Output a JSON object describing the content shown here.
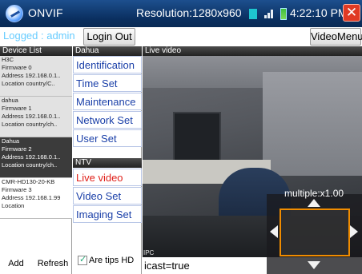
{
  "titlebar": {
    "app_title": "ONVIF",
    "resolution": "Resolution:1280x960",
    "clock": "4:22:10 PM",
    "close_glyph": "✕",
    "icons": [
      "app-logo-icon",
      "signal-icon",
      "network-icon",
      "battery-icon",
      "close-icon"
    ]
  },
  "toolbar": {
    "logged_status": "Logged : admin",
    "logout_label": "Login Out",
    "videomenu_label": "VideoMenu"
  },
  "device_list": {
    "header": "Device List",
    "devices": [
      {
        "name": "H3C",
        "firmware": "Firmware 0",
        "address": "Address 192.168.0.1..",
        "location": "Location country/C.."
      },
      {
        "name": "dahua",
        "firmware": "Firmware 1",
        "address": "Address 192.168.0.1..",
        "location": "Location country/ch.."
      },
      {
        "name": "Dahua",
        "firmware": "Firmware 2",
        "address": "Address 192.168.0.1..",
        "location": "Location country/ch.."
      },
      {
        "name": "CMR-HD130-20-KB",
        "firmware": "Firmware 3",
        "address": "Address 192.168.1.99",
        "location": "Location"
      }
    ],
    "selected_index": 2,
    "add_label": "Add",
    "refresh_label": "Refresh"
  },
  "menu": {
    "dahua_header": "Dahua",
    "items": [
      "Identification",
      "Time Set",
      "Maintenance",
      "Network Set",
      "User Set"
    ],
    "ntv_header": "NTV",
    "ntv_items": [
      "Live video",
      "Video Set",
      "Imaging Set"
    ],
    "active_item": "Live video",
    "tips_label": "Are tips HD",
    "tips_checked": true
  },
  "video": {
    "header": "Live video",
    "ipc_label": "IPC",
    "status_line": "icast=true",
    "multiple": "multiple:x1.00"
  },
  "colors": {
    "titlebar": "#0a2f5f",
    "logged_status": "#66ccff",
    "menu_text": "#1a3fa8",
    "active_menu_text": "#e0201a",
    "ptz_border": "#f08c00",
    "close_button": "#e03a24"
  }
}
